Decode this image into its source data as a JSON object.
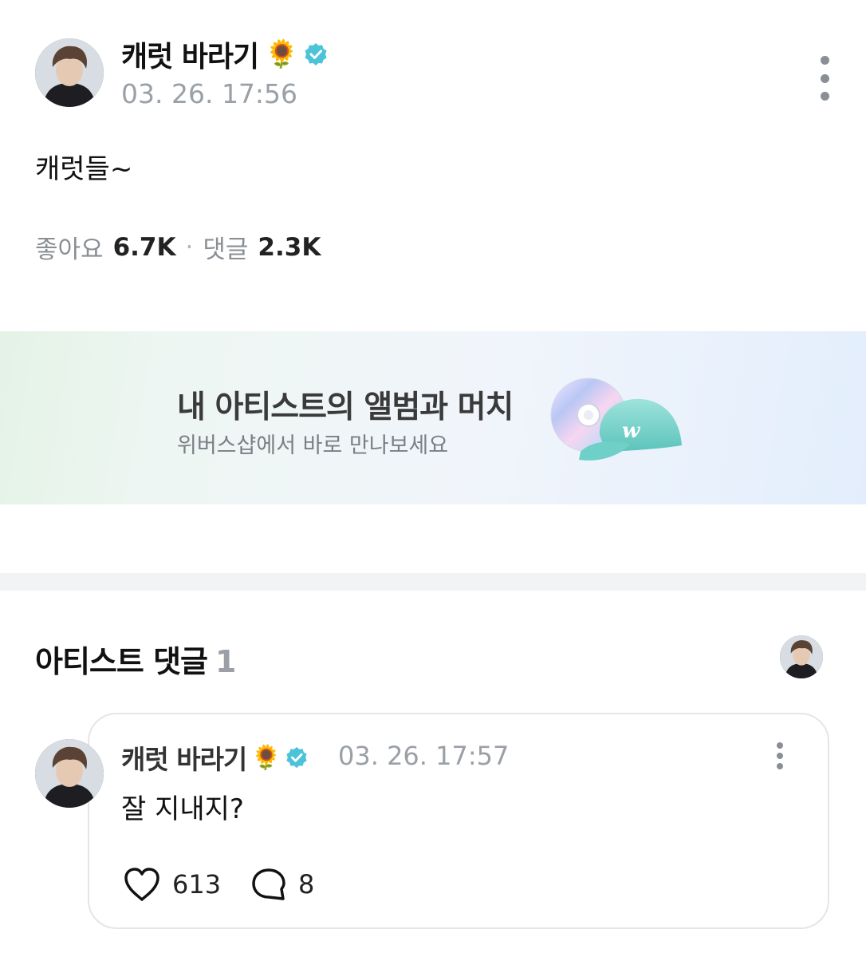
{
  "post": {
    "author": "캐럿 바라기",
    "author_emoji": "🌻",
    "verified_icon": "verified-badge-icon",
    "timestamp": "03. 26. 17:56",
    "content": "캐럿들~",
    "likes_label": "좋아요",
    "likes_count": "6.7K",
    "separator": "·",
    "comments_label": "댓글",
    "comments_count": "2.3K"
  },
  "banner": {
    "title": "내 아티스트의 앨범과 머치",
    "subtitle": "위버스샵에서 바로 만나보세요"
  },
  "artist_comments": {
    "title": "아티스트 댓글",
    "count": "1"
  },
  "comment": {
    "author": "캐럿 바라기",
    "author_emoji": "🌻",
    "timestamp": "03. 26. 17:57",
    "content": "잘 지내지?",
    "like_count": "613",
    "reply_count": "8"
  },
  "colors": {
    "verified": "#4cc3d9",
    "muted": "#9aa0a6",
    "cap": "#7fd6cf"
  }
}
